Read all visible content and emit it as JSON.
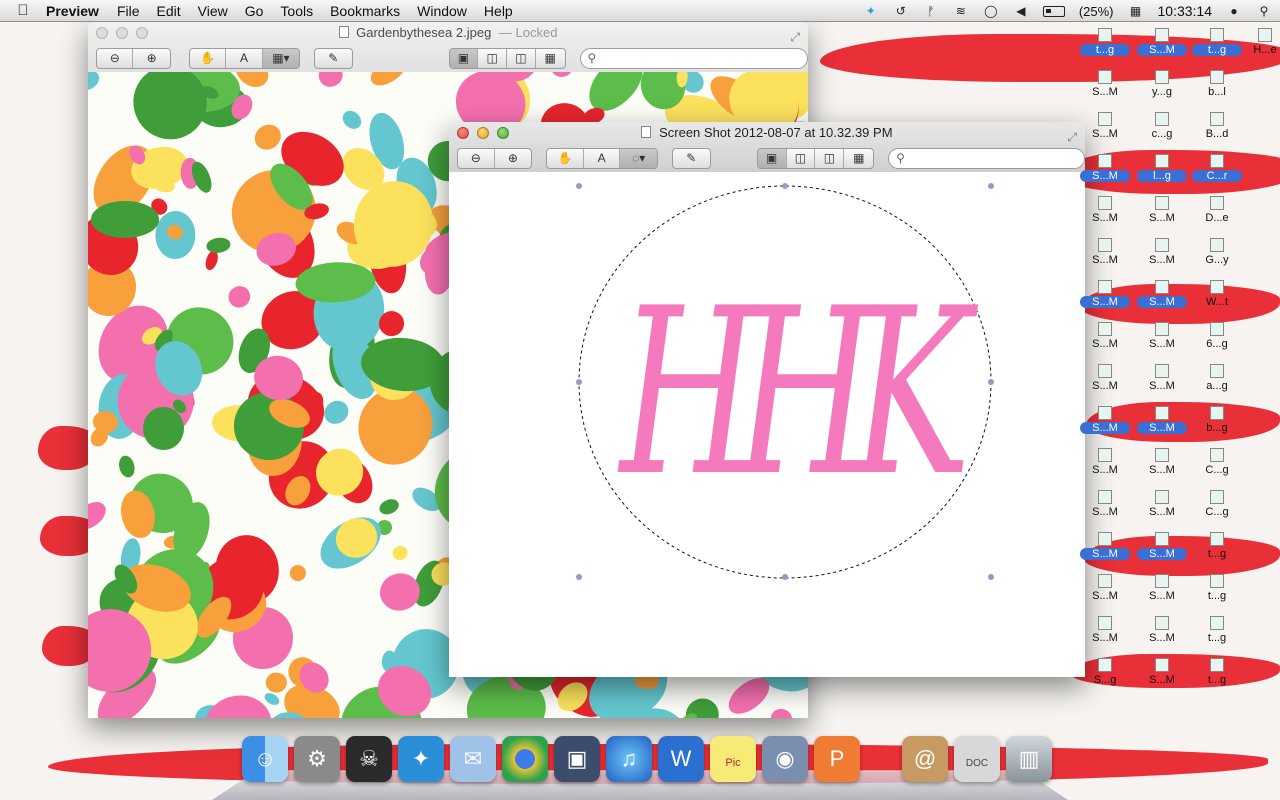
{
  "menubar": {
    "app_name": "Preview",
    "menus": [
      "File",
      "Edit",
      "View",
      "Go",
      "Tools",
      "Bookmarks",
      "Window",
      "Help"
    ],
    "battery_text": "(25%)",
    "clock": "10:33:14",
    "status_icons": [
      "twitter-icon",
      "time-machine-icon",
      "bluetooth-icon",
      "wifi-icon",
      "messages-icon",
      "volume-icon",
      "battery-icon",
      "calendar-icon",
      "user-icon",
      "spotlight-icon"
    ]
  },
  "window_back": {
    "title": "Gardenbythesea 2.jpeg",
    "title_suffix": "— Locked"
  },
  "window_front": {
    "title": "Screen Shot 2012-08-07 at 10.32.39 PM",
    "monogram": "HHK"
  },
  "desktop_icons": [
    [
      "t...g",
      "S...M",
      "t...g",
      "H...e"
    ],
    [
      "S...M",
      "y...g",
      "b...l"
    ],
    [
      "S...M",
      "c...g",
      "B...d"
    ],
    [
      "S...M",
      "l...g",
      "C...r"
    ],
    [
      "S...M",
      "S...M",
      "D...e"
    ],
    [
      "S...M",
      "S...M",
      "G...y"
    ],
    [
      "S...M",
      "S...M",
      "W...t"
    ],
    [
      "S...M",
      "S...M",
      "6...g"
    ],
    [
      "S...M",
      "S...M",
      "a...g"
    ],
    [
      "S...M",
      "S...M",
      "b...g"
    ],
    [
      "S...M",
      "S...M",
      "C...g"
    ],
    [
      "S...M",
      "S...M",
      "C...g"
    ],
    [
      "S...M",
      "S...M",
      "t...g"
    ],
    [
      "S...M",
      "S...M",
      "t...g"
    ],
    [
      "S...M",
      "S...M",
      "t...g"
    ],
    [
      "S...g",
      "S...M",
      "t...g"
    ]
  ],
  "dock": {
    "items": [
      "finder-icon",
      "system-preferences-icon",
      "skull-app-icon",
      "twitter-icon",
      "mail-icon",
      "chrome-icon",
      "iphoto-icon",
      "itunes-icon",
      "word-icon",
      "stickies-icon",
      "preview-icon",
      "powerpoint-icon",
      "address-book-icon",
      "documents-icon",
      "trash-icon"
    ],
    "stickies_text": "Pic",
    "doc_label": "DOC"
  },
  "colors": {
    "accent_pink": "#f57abd",
    "stroke_red": "#e8242d",
    "selection_blue": "#3a6fd6"
  }
}
